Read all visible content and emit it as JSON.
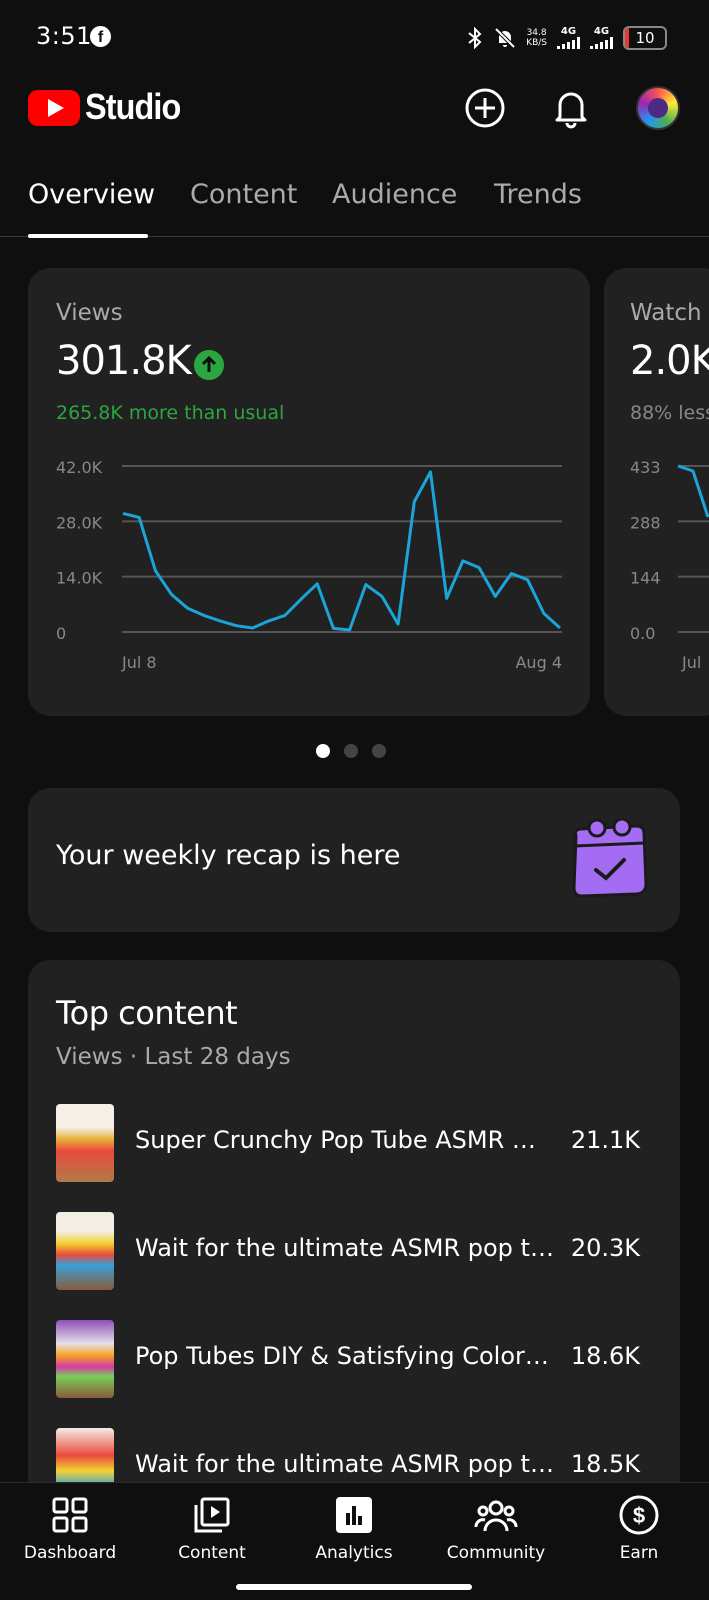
{
  "status_bar": {
    "time": "3:51",
    "net_speed_value": "34.8",
    "net_speed_unit": "KB/S",
    "signal1": "4G",
    "signal2": "4G",
    "battery": "10"
  },
  "header": {
    "app_name": "Studio",
    "icons": [
      "create-icon",
      "bell-icon",
      "avatar"
    ]
  },
  "tabs": [
    {
      "label": "Overview",
      "active": true
    },
    {
      "label": "Content",
      "active": false
    },
    {
      "label": "Audience",
      "active": false
    },
    {
      "label": "Trends",
      "active": false
    }
  ],
  "views_card": {
    "label": "Views",
    "value": "301.8K",
    "sub": "265.8K more than usual",
    "sub_color": "#2ba640",
    "chart_data": {
      "type": "line",
      "x_start_label": "Jul 8",
      "x_end_label": "Aug 4",
      "y_ticks": [
        "0",
        "14.0K",
        "28.0K",
        "42.0K"
      ],
      "ylim": [
        0,
        42000
      ],
      "color": "#1aa4d8",
      "values": [
        30000,
        29000,
        15500,
        9500,
        6000,
        4200,
        2800,
        1600,
        1000,
        2800,
        4200,
        8300,
        12200,
        900,
        500,
        12000,
        9000,
        2000,
        33000,
        40500,
        8500,
        18000,
        16300,
        9000,
        14800,
        13200,
        4700,
        1000
      ]
    }
  },
  "watch_card": {
    "label": "Watch",
    "value": "2.0K",
    "sub": "88% less",
    "chart_data": {
      "type": "line",
      "x_start_label": "Jul",
      "y_ticks": [
        "0.0",
        "144",
        "288",
        "433"
      ],
      "ylim": [
        0,
        433
      ],
      "color": "#1aa4d8",
      "values": [
        433,
        420,
        300
      ]
    }
  },
  "pager": {
    "count": 3,
    "active": 0
  },
  "recap": {
    "text": "Your weekly recap is here",
    "icon": "calendar-check-icon"
  },
  "top_content": {
    "title": "Top content",
    "subtitle": "Views · Last 28 days",
    "items": [
      {
        "title": "Super Crunchy Pop Tube ASMR 🌈#...",
        "views": "21.1K"
      },
      {
        "title": "Wait for the ultimate ASMR pop tub...",
        "views": "20.3K"
      },
      {
        "title": "Pop Tubes DIY & Satisfying Color M...",
        "views": "18.6K"
      },
      {
        "title": "Wait for the ultimate ASMR pop tube...",
        "views": "18.5K"
      }
    ]
  },
  "bottom_nav": [
    {
      "label": "Dashboard",
      "icon": "dashboard-icon"
    },
    {
      "label": "Content",
      "icon": "content-icon"
    },
    {
      "label": "Analytics",
      "icon": "analytics-icon"
    },
    {
      "label": "Community",
      "icon": "community-icon"
    },
    {
      "label": "Earn",
      "icon": "earn-icon"
    }
  ]
}
